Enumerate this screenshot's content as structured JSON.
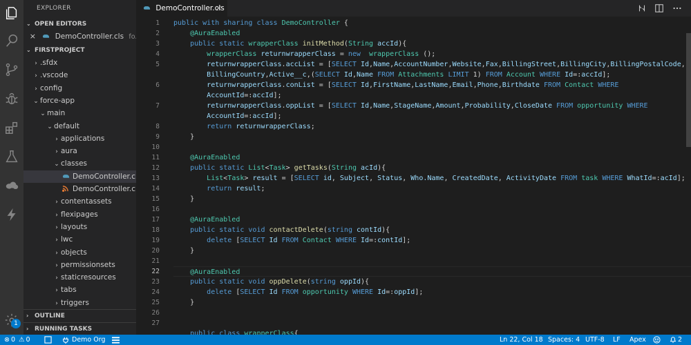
{
  "activity_bar": {
    "items": [
      "explorer-icon",
      "search-icon",
      "source-control-icon",
      "debug-icon",
      "extensions-icon",
      "test-icon",
      "salesforce-icon",
      "lightning-icon"
    ],
    "settings_badge": "1"
  },
  "sidebar": {
    "title": "EXPLORER",
    "open_editors": {
      "label": "OPEN EDITORS",
      "items": [
        {
          "name": "DemoController.cls",
          "path": "fo..."
        }
      ]
    },
    "project": {
      "label": "FIRSTPROJECT",
      "tree": [
        {
          "label": ".sfdx",
          "depth": 0,
          "chev": "›"
        },
        {
          "label": ".vscode",
          "depth": 0,
          "chev": "›"
        },
        {
          "label": "config",
          "depth": 0,
          "chev": "›"
        },
        {
          "label": "force-app",
          "depth": 0,
          "chev": "⌄"
        },
        {
          "label": "main",
          "depth": 1,
          "chev": "⌄"
        },
        {
          "label": "default",
          "depth": 2,
          "chev": "⌄"
        },
        {
          "label": "applications",
          "depth": 3,
          "chev": "›"
        },
        {
          "label": "aura",
          "depth": 3,
          "chev": "›"
        },
        {
          "label": "classes",
          "depth": 3,
          "chev": "⌄"
        },
        {
          "label": "DemoController.cls",
          "depth": 4,
          "chev": "",
          "file": "cls",
          "selected": true
        },
        {
          "label": "DemoController.cls-...",
          "depth": 4,
          "chev": "",
          "file": "xml"
        },
        {
          "label": "contentassets",
          "depth": 3,
          "chev": "›"
        },
        {
          "label": "flexipages",
          "depth": 3,
          "chev": "›"
        },
        {
          "label": "layouts",
          "depth": 3,
          "chev": "›"
        },
        {
          "label": "lwc",
          "depth": 3,
          "chev": "›"
        },
        {
          "label": "objects",
          "depth": 3,
          "chev": "›"
        },
        {
          "label": "permissionsets",
          "depth": 3,
          "chev": "›"
        },
        {
          "label": "staticresources",
          "depth": 3,
          "chev": "›"
        },
        {
          "label": "tabs",
          "depth": 3,
          "chev": "›"
        },
        {
          "label": "triggers",
          "depth": 3,
          "chev": "›"
        }
      ]
    },
    "outline_label": "OUTLINE",
    "running_tasks_label": "RUNNING TASKS"
  },
  "tab": {
    "label": "DemoController.cls",
    "close": "×"
  },
  "editor": {
    "current_line": 22,
    "lines": [
      {
        "n": "1",
        "html": "<span class='kw'>public</span> <span class='kw'>with</span> <span class='kw'>sharing</span> <span class='kw'>class</span> <span class='ty'>DemoController</span> {"
      },
      {
        "n": "2",
        "html": "    <span class='ann'>@AuraEnabled</span>"
      },
      {
        "n": "3",
        "html": "    <span class='kw'>public</span> <span class='kw'>static</span> <span class='ty'>wrapperClass</span> <span class='fn'>initMethod</span>(<span class='ty'>String</span> <span class='vr'>accId</span>){"
      },
      {
        "n": "4",
        "html": "        <span class='ty'>wrapperClass</span> <span class='vr'>returnwrapperClass</span> = <span class='kw'>new</span>  <span class='ty'>wrapperClass</span> ();"
      },
      {
        "n": "5",
        "html": "        <span class='vr'>returnwrapperClass</span>.<span class='vr'>accList</span> = [<span class='kw'>SELECT</span> <span class='vr'>Id</span>,<span class='vr'>Name</span>,<span class='vr'>AccountNumber</span>,<span class='vr'>Website</span>,<span class='vr'>Fax</span>,<span class='vr'>BillingStreet</span>,<span class='vr'>BillingCity</span>,<span class='vr'>BillingPostalCode</span>,"
      },
      {
        "n": "",
        "html": "        <span class='vr'>BillingCountry</span>,<span class='vr'>Active__c</span>,(<span class='kw'>SELECT</span> <span class='vr'>Id</span>,<span class='vr'>Name</span> <span class='kw'>FROM</span> <span class='ty'>Attachments</span> <span class='kw'>LIMIT</span> 1) <span class='kw'>FROM</span> <span class='ty'>Account</span> <span class='kw'>WHERE</span> <span class='vr'>Id</span>=:<span class='vr'>accId</span>];"
      },
      {
        "n": "6",
        "html": "        <span class='vr'>returnwrapperClass</span>.<span class='vr'>conList</span> = [<span class='kw'>SELECT</span> <span class='vr'>Id</span>,<span class='vr'>FirstName</span>,<span class='vr'>LastName</span>,<span class='vr'>Email</span>,<span class='vr'>Phone</span>,<span class='vr'>Birthdate</span> <span class='kw'>FROM</span> <span class='ty'>Contact</span> <span class='kw'>WHERE</span>"
      },
      {
        "n": "",
        "html": "        <span class='vr'>AccountId</span>=:<span class='vr'>accId</span>];"
      },
      {
        "n": "7",
        "html": "        <span class='vr'>returnwrapperClass</span>.<span class='vr'>oppList</span> = [<span class='kw'>SELECT</span> <span class='vr'>Id</span>,<span class='vr'>Name</span>,<span class='vr'>StageName</span>,<span class='vr'>Amount</span>,<span class='vr'>Probability</span>,<span class='vr'>CloseDate</span> <span class='kw'>FROM</span> <span class='ty'>opportunity</span> <span class='kw'>WHERE</span>"
      },
      {
        "n": "",
        "html": "        <span class='vr'>AccountId</span>=:<span class='vr'>accId</span>];"
      },
      {
        "n": "8",
        "html": "        <span class='kw'>return</span> <span class='vr'>returnwrapperClass</span>;"
      },
      {
        "n": "9",
        "html": "    }"
      },
      {
        "n": "10",
        "html": ""
      },
      {
        "n": "11",
        "html": "    <span class='ann'>@AuraEnabled</span>"
      },
      {
        "n": "12",
        "html": "    <span class='kw'>public</span> <span class='kw'>static</span> <span class='ty'>List</span>&lt;<span class='ty'>Task</span>&gt; <span class='fn'>getTasks</span>(<span class='ty'>String</span> <span class='vr'>acId</span>){"
      },
      {
        "n": "13",
        "html": "        <span class='ty'>List</span>&lt;<span class='ty'>Task</span>&gt; <span class='vr'>result</span> = [<span class='kw'>SELECT</span> <span class='vr'>id</span>, <span class='vr'>Subject</span>, <span class='vr'>Status</span>, <span class='vr'>Who.Name</span>, <span class='vr'>CreatedDate</span>, <span class='vr'>ActivityDate</span> <span class='kw'>FROM</span> <span class='ty'>task</span> <span class='kw'>WHERE</span> <span class='vr'>WhatId</span>=:<span class='vr'>acId</span>];"
      },
      {
        "n": "14",
        "html": "        <span class='kw'>return</span> <span class='vr'>result</span>;"
      },
      {
        "n": "15",
        "html": "    }"
      },
      {
        "n": "16",
        "html": ""
      },
      {
        "n": "17",
        "html": "    <span class='ann'>@AuraEnabled</span>"
      },
      {
        "n": "18",
        "html": "    <span class='kw'>public</span> <span class='kw'>static</span> <span class='kw'>void</span> <span class='fn'>contactDelete</span>(<span class='kw'>string</span> <span class='vr'>contId</span>){"
      },
      {
        "n": "19",
        "html": "        <span class='kw'>delete</span> [<span class='kw'>SELECT</span> <span class='vr'>Id</span> <span class='kw'>FROM</span> <span class='ty'>Contact</span> <span class='kw'>WHERE</span> <span class='vr'>Id</span>=:<span class='vr'>contId</span>];"
      },
      {
        "n": "20",
        "html": "    }"
      },
      {
        "n": "21",
        "html": ""
      },
      {
        "n": "22",
        "html": "    <span class='ann'>@AuraEnabled</span>"
      },
      {
        "n": "23",
        "html": "    <span class='kw'>public</span> <span class='kw'>static</span> <span class='kw'>void</span> <span class='fn'>oppDelete</span>(<span class='kw'>string</span> <span class='vr'>oppId</span>){"
      },
      {
        "n": "24",
        "html": "        <span class='kw'>delete</span> [<span class='kw'>SELECT</span> <span class='vr'>Id</span> <span class='kw'>FROM</span> <span class='ty'>opportunity</span> <span class='kw'>WHERE</span> <span class='vr'>Id</span>=:<span class='vr'>oppId</span>];"
      },
      {
        "n": "25",
        "html": "    }"
      },
      {
        "n": "26",
        "html": ""
      },
      {
        "n": "27",
        "html": ""
      },
      {
        "n": "",
        "html": "    <span class='kw'>public</span> <span class='kw'>class</span> <span class='ty'>wrapperClass</span>{"
      }
    ]
  },
  "status": {
    "errors": "0",
    "warnings": "0",
    "org": "Demo Org",
    "position": "Ln 22, Col 18",
    "spaces": "Spaces: 4",
    "encoding": "UTF-8",
    "eol": "LF",
    "language": "Apex",
    "notifications": "2"
  },
  "colors": {
    "accent": "#007acc",
    "cls_icon": "#519aba",
    "xml_icon": "#e37933"
  }
}
